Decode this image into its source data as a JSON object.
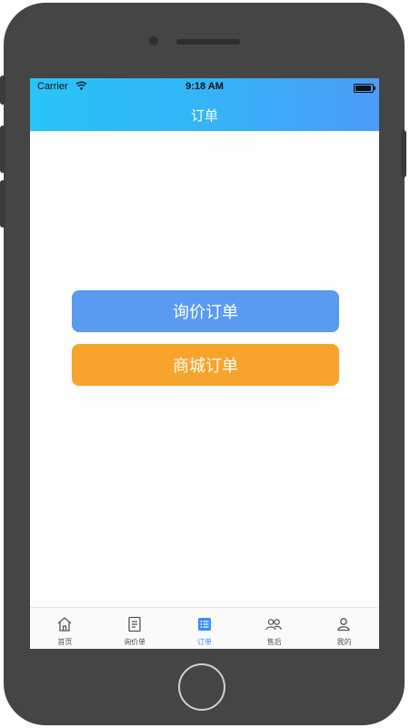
{
  "status_bar": {
    "carrier": "Carrier",
    "time": "9:18 AM"
  },
  "header": {
    "title": "订单"
  },
  "main": {
    "inquiry_orders_label": "询价订单",
    "mall_orders_label": "商城订单"
  },
  "tabbar": {
    "items": [
      {
        "label": "首页",
        "icon": "home-icon"
      },
      {
        "label": "询价单",
        "icon": "document-icon"
      },
      {
        "label": "订单",
        "icon": "list-icon",
        "active": true
      },
      {
        "label": "售后",
        "icon": "people-icon"
      },
      {
        "label": "我的",
        "icon": "user-icon"
      }
    ]
  },
  "colors": {
    "header_start": "#29c4f6",
    "header_end": "#4a9cf7",
    "inquiry_button": "#5b9bef",
    "mall_button": "#f6a42c",
    "tab_active": "#3a8ef6"
  }
}
